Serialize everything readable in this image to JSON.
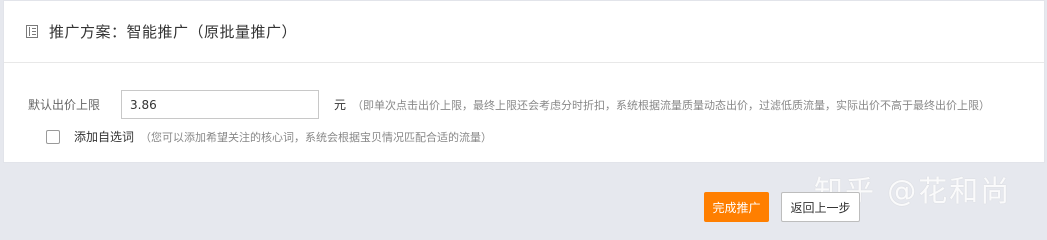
{
  "panel": {
    "title": "推广方案：智能推广（原批量推广）"
  },
  "bid": {
    "label": "默认出价上限",
    "value": "3.86",
    "unit": "元",
    "note": "（即单次点击出价上限，最终上限还会考虑分时折扣，系统根据流量质量动态出价，过滤低质流量，实际出价不高于最终出价上限）"
  },
  "keywords": {
    "checked": false,
    "label": "添加自选词",
    "note": "（您可以添加希望关注的核心词，系统会根据宝贝情况匹配合适的流量）"
  },
  "actions": {
    "finish_label": "完成推广",
    "back_label": "返回上一步"
  },
  "watermark": {
    "text": "知乎 @花和尚"
  },
  "colors": {
    "accent": "#ff7f00",
    "page_background": "#e6e8ee",
    "panel_background": "#ffffff"
  }
}
